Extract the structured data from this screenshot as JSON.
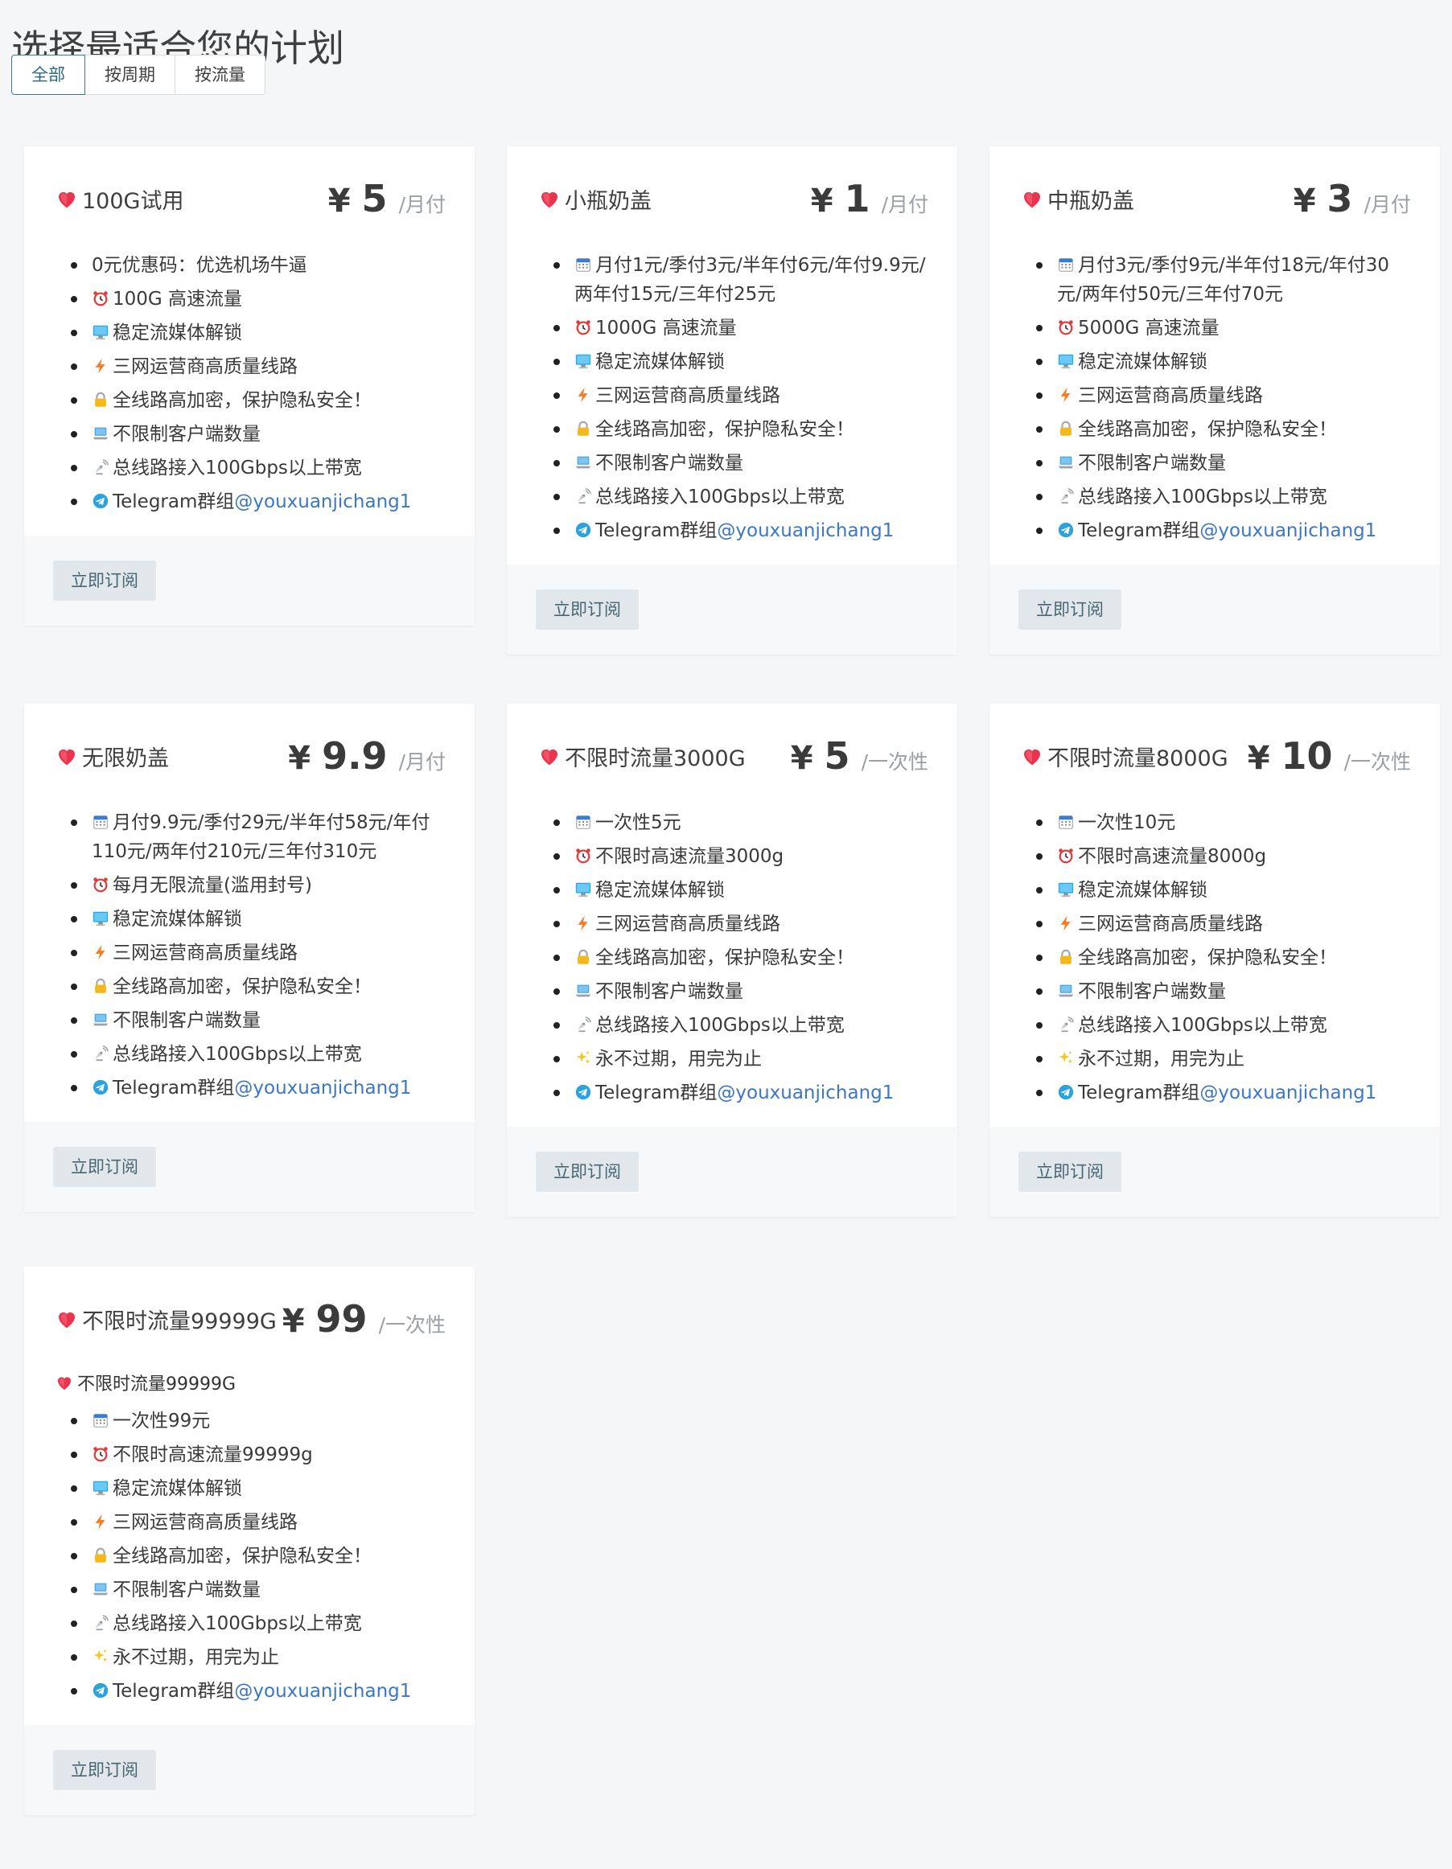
{
  "page": {
    "title": "选择最适合您的计划"
  },
  "tabs": [
    {
      "label": "全部",
      "active": true
    },
    {
      "label": "按周期",
      "active": false
    },
    {
      "label": "按流量",
      "active": false
    }
  ],
  "subscribe_label": "立即订阅",
  "currency": "¥",
  "colors": {
    "accent": "#3b7a94",
    "link": "#3b76c7",
    "heart": "#e8344e",
    "button_bg": "#e1e7ea"
  },
  "plans": [
    {
      "name": "100G试用",
      "price": "5",
      "period": "/月付",
      "features": [
        {
          "icon": "none",
          "text": "0元优惠码：优选机场牛逼"
        },
        {
          "icon": "alarm-clock-icon",
          "text": "100G 高速流量"
        },
        {
          "icon": "monitor-icon",
          "text": "稳定流媒体解锁"
        },
        {
          "icon": "lightning-icon",
          "text": "三网运营商高质量线路"
        },
        {
          "icon": "lock-icon",
          "text": "全线路高加密，保护隐私安全！"
        },
        {
          "icon": "laptop-icon",
          "text": "不限制客户端数量"
        },
        {
          "icon": "satellite-icon",
          "text": "总线路接入100Gbps以上带宽"
        },
        {
          "icon": "telegram-icon",
          "text": "Telegram群组",
          "link": "@youxuanjichang1"
        }
      ]
    },
    {
      "name": "小瓶奶盖",
      "price": "1",
      "period": "/月付",
      "features": [
        {
          "icon": "calendar-icon",
          "text": "月付1元/季付3元/半年付6元/年付9.9元/两年付15元/三年付25元"
        },
        {
          "icon": "alarm-clock-icon",
          "text": "1000G 高速流量"
        },
        {
          "icon": "monitor-icon",
          "text": "稳定流媒体解锁"
        },
        {
          "icon": "lightning-icon",
          "text": "三网运营商高质量线路"
        },
        {
          "icon": "lock-icon",
          "text": "全线路高加密，保护隐私安全！"
        },
        {
          "icon": "laptop-icon",
          "text": "不限制客户端数量"
        },
        {
          "icon": "satellite-icon",
          "text": "总线路接入100Gbps以上带宽"
        },
        {
          "icon": "telegram-icon",
          "text": "Telegram群组",
          "link": "@youxuanjichang1"
        }
      ]
    },
    {
      "name": "中瓶奶盖",
      "price": "3",
      "period": "/月付",
      "features": [
        {
          "icon": "calendar-icon",
          "text": "月付3元/季付9元/半年付18元/年付30元/两年付50元/三年付70元"
        },
        {
          "icon": "alarm-clock-icon",
          "text": "5000G 高速流量"
        },
        {
          "icon": "monitor-icon",
          "text": "稳定流媒体解锁"
        },
        {
          "icon": "lightning-icon",
          "text": "三网运营商高质量线路"
        },
        {
          "icon": "lock-icon",
          "text": "全线路高加密，保护隐私安全！"
        },
        {
          "icon": "laptop-icon",
          "text": "不限制客户端数量"
        },
        {
          "icon": "satellite-icon",
          "text": "总线路接入100Gbps以上带宽"
        },
        {
          "icon": "telegram-icon",
          "text": "Telegram群组",
          "link": "@youxuanjichang1"
        }
      ]
    },
    {
      "name": "无限奶盖",
      "price": "9.9",
      "period": "/月付",
      "features": [
        {
          "icon": "calendar-icon",
          "text": "月付9.9元/季付29元/半年付58元/年付110元/两年付210元/三年付310元"
        },
        {
          "icon": "alarm-clock-icon",
          "text": "每月无限流量(滥用封号)"
        },
        {
          "icon": "monitor-icon",
          "text": "稳定流媒体解锁"
        },
        {
          "icon": "lightning-icon",
          "text": "三网运营商高质量线路"
        },
        {
          "icon": "lock-icon",
          "text": "全线路高加密，保护隐私安全！"
        },
        {
          "icon": "laptop-icon",
          "text": "不限制客户端数量"
        },
        {
          "icon": "satellite-icon",
          "text": "总线路接入100Gbps以上带宽"
        },
        {
          "icon": "telegram-icon",
          "text": "Telegram群组",
          "link": "@youxuanjichang1"
        }
      ]
    },
    {
      "name": "不限时流量3000G",
      "price": "5",
      "period": "/一次性",
      "features": [
        {
          "icon": "calendar-icon",
          "text": "一次性5元"
        },
        {
          "icon": "alarm-clock-icon",
          "text": "不限时高速流量3000g"
        },
        {
          "icon": "monitor-icon",
          "text": "稳定流媒体解锁"
        },
        {
          "icon": "lightning-icon",
          "text": "三网运营商高质量线路"
        },
        {
          "icon": "lock-icon",
          "text": "全线路高加密，保护隐私安全！"
        },
        {
          "icon": "laptop-icon",
          "text": "不限制客户端数量"
        },
        {
          "icon": "satellite-icon",
          "text": "总线路接入100Gbps以上带宽"
        },
        {
          "icon": "sparkles-icon",
          "text": "永不过期，用完为止"
        },
        {
          "icon": "telegram-icon",
          "text": "Telegram群组",
          "link": "@youxuanjichang1"
        }
      ]
    },
    {
      "name": "不限时流量8000G",
      "price": "10",
      "period": "/一次性",
      "features": [
        {
          "icon": "calendar-icon",
          "text": "一次性10元"
        },
        {
          "icon": "alarm-clock-icon",
          "text": "不限时高速流量8000g"
        },
        {
          "icon": "monitor-icon",
          "text": "稳定流媒体解锁"
        },
        {
          "icon": "lightning-icon",
          "text": "三网运营商高质量线路"
        },
        {
          "icon": "lock-icon",
          "text": "全线路高加密，保护隐私安全！"
        },
        {
          "icon": "laptop-icon",
          "text": "不限制客户端数量"
        },
        {
          "icon": "satellite-icon",
          "text": "总线路接入100Gbps以上带宽"
        },
        {
          "icon": "sparkles-icon",
          "text": "永不过期，用完为止"
        },
        {
          "icon": "telegram-icon",
          "text": "Telegram群组",
          "link": "@youxuanjichang1"
        }
      ]
    },
    {
      "name": "不限时流量99999G",
      "price": "99",
      "period": "/一次性",
      "subtitle": "不限时流量99999G",
      "features": [
        {
          "icon": "calendar-icon",
          "text": "一次性99元"
        },
        {
          "icon": "alarm-clock-icon",
          "text": "不限时高速流量99999g"
        },
        {
          "icon": "monitor-icon",
          "text": "稳定流媒体解锁"
        },
        {
          "icon": "lightning-icon",
          "text": "三网运营商高质量线路"
        },
        {
          "icon": "lock-icon",
          "text": "全线路高加密，保护隐私安全！"
        },
        {
          "icon": "laptop-icon",
          "text": "不限制客户端数量"
        },
        {
          "icon": "satellite-icon",
          "text": "总线路接入100Gbps以上带宽"
        },
        {
          "icon": "sparkles-icon",
          "text": "永不过期，用完为止"
        },
        {
          "icon": "telegram-icon",
          "text": "Telegram群组",
          "link": "@youxuanjichang1"
        }
      ]
    }
  ]
}
